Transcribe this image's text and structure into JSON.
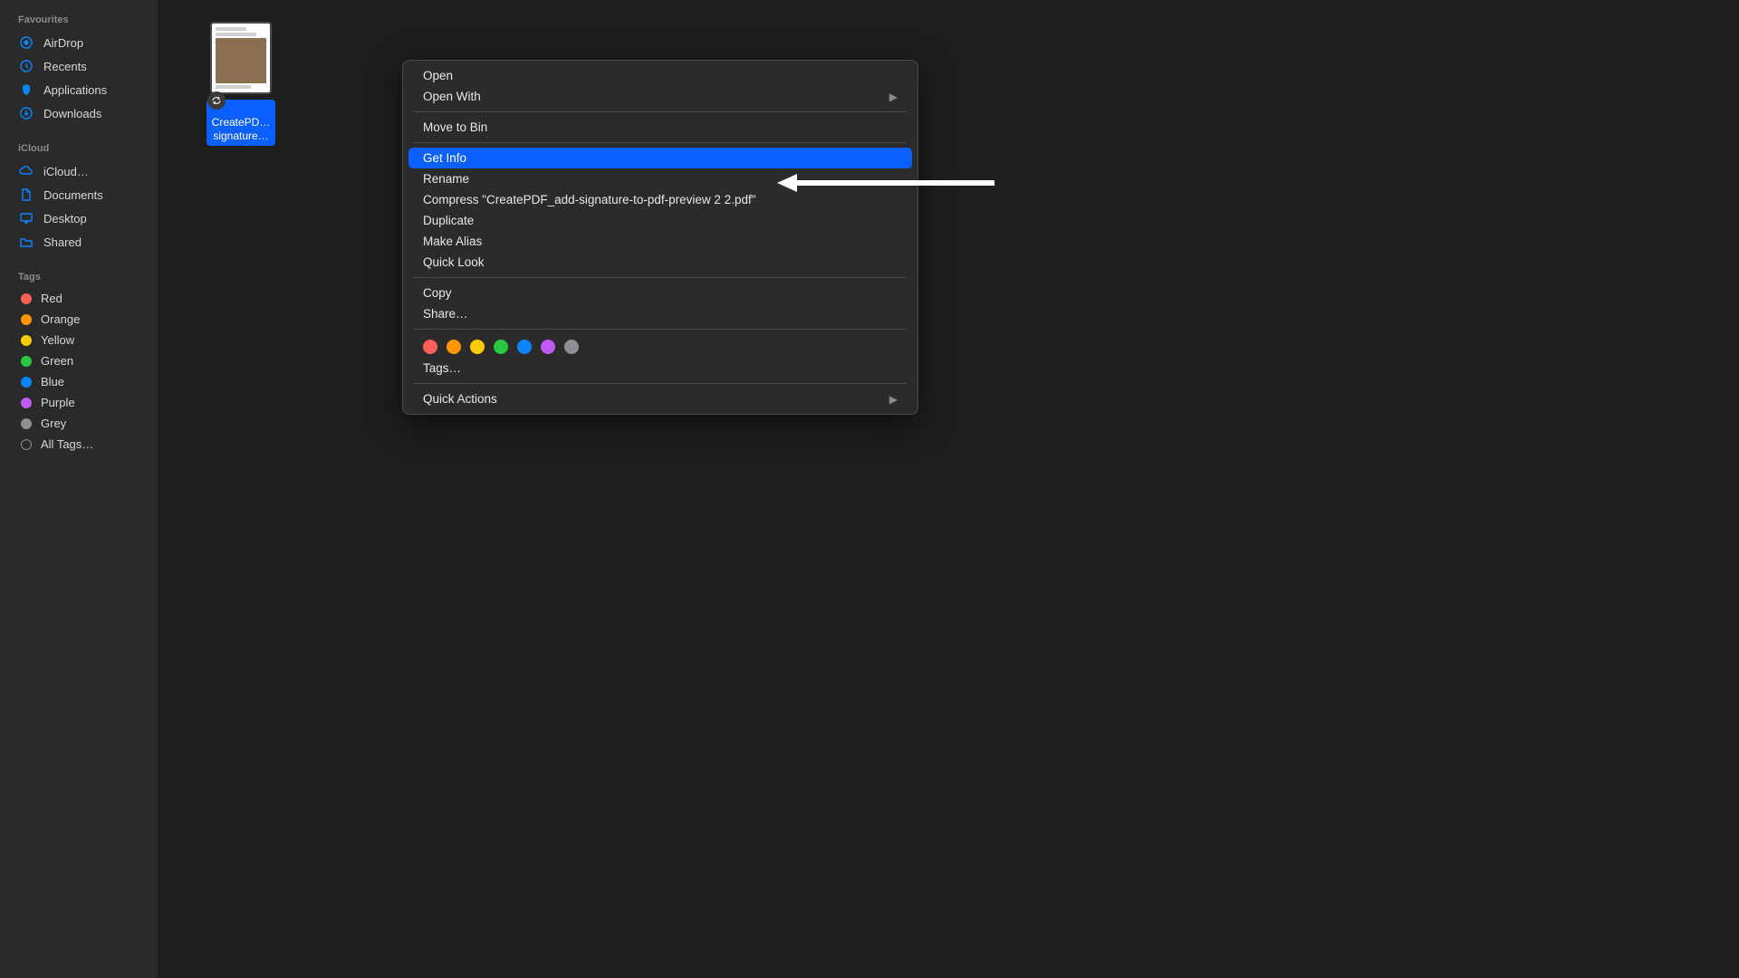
{
  "sidebar": {
    "sections": [
      {
        "title": "Favourites",
        "items": [
          {
            "icon": "airdrop-icon",
            "label": "AirDrop"
          },
          {
            "icon": "recents-icon",
            "label": "Recents"
          },
          {
            "icon": "applications-icon",
            "label": "Applications"
          },
          {
            "icon": "downloads-icon",
            "label": "Downloads"
          }
        ]
      },
      {
        "title": "iCloud",
        "items": [
          {
            "icon": "cloud-icon",
            "label": "iCloud…"
          },
          {
            "icon": "documents-icon",
            "label": "Documents"
          },
          {
            "icon": "desktop-icon",
            "label": "Desktop"
          },
          {
            "icon": "shared-icon",
            "label": "Shared"
          }
        ]
      },
      {
        "title": "Tags",
        "items": [
          {
            "color": "red",
            "label": "Red"
          },
          {
            "color": "orange",
            "label": "Orange"
          },
          {
            "color": "yellow",
            "label": "Yellow"
          },
          {
            "color": "green",
            "label": "Green"
          },
          {
            "color": "blue",
            "label": "Blue"
          },
          {
            "color": "purple",
            "label": "Purple"
          },
          {
            "color": "grey",
            "label": "Grey"
          },
          {
            "color": "outline",
            "label": "All Tags…"
          }
        ]
      }
    ]
  },
  "file": {
    "label_line1": "CreatePD…",
    "label_line2": "signature…"
  },
  "context_menu": {
    "open": "Open",
    "open_with": "Open With",
    "move_to_bin": "Move to Bin",
    "get_info": "Get Info",
    "rename": "Rename",
    "compress": "Compress \"CreatePDF_add-signature-to-pdf-preview 2 2.pdf\"",
    "duplicate": "Duplicate",
    "make_alias": "Make Alias",
    "quick_look": "Quick Look",
    "copy": "Copy",
    "share": "Share…",
    "tags": "Tags…",
    "quick_actions": "Quick Actions",
    "highlighted": "get_info",
    "tag_colors": [
      "#ff5f57",
      "#ff9500",
      "#ffcc00",
      "#28c840",
      "#0a84ff",
      "#bf5af2",
      "#8e8e93"
    ]
  }
}
